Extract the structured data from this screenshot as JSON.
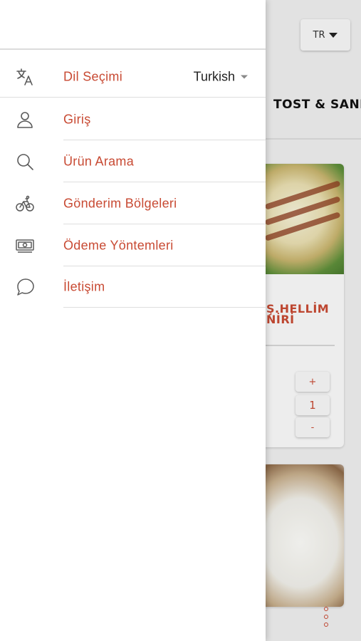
{
  "background": {
    "language_button": "TR",
    "category_title": "TOST & SAND",
    "product_name_line1": "Ş.HELLİM",
    "product_name_line2": "NİRİ",
    "quantity": {
      "plus": "+",
      "value": "1",
      "minus": "-"
    }
  },
  "drawer": {
    "items": [
      {
        "label": "Dil Seçimi",
        "icon": "translate-icon",
        "selected_language": "Turkish"
      },
      {
        "label": "Giriş",
        "icon": "user-icon"
      },
      {
        "label": "Ürün Arama",
        "icon": "search-icon"
      },
      {
        "label": "Gönderim Bölgeleri",
        "icon": "bicycle-icon"
      },
      {
        "label": "Ödeme Yöntemleri",
        "icon": "banknote-icon"
      },
      {
        "label": "İletişim",
        "icon": "chat-bubble-icon"
      }
    ]
  },
  "colors": {
    "accent": "#c84a33",
    "text": "#222222",
    "divider": "#dedede",
    "icon": "#5a5a5a"
  }
}
